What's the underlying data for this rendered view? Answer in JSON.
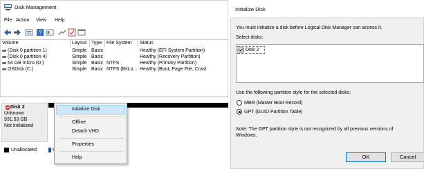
{
  "disk_management": {
    "title": "Disk Management",
    "menu": [
      "File",
      "Action",
      "View",
      "Help"
    ],
    "toolbar_icons": [
      "back-icon",
      "forward-icon",
      "list-view-icon",
      "help-icon",
      "properties-icon",
      "connect-icon",
      "check-icon",
      "panel-icon"
    ],
    "volume_table": {
      "columns": [
        "Volume",
        "Layout",
        "Type",
        "File System",
        "Status"
      ],
      "rows": [
        {
          "volume": "(Disk 0 partition 1)",
          "layout": "Simple",
          "type": "Basic",
          "fs": "",
          "status": "Healthy (EFI System Partition)"
        },
        {
          "volume": "(Disk 0 partition 4)",
          "layout": "Simple",
          "type": "Basic",
          "fs": "",
          "status": "Healthy (Recovery Partition)"
        },
        {
          "volume": "64 GB micro (D:)",
          "layout": "Simple",
          "type": "Basic",
          "fs": "NTFS",
          "status": "Healthy (Primary Partition)"
        },
        {
          "volume": "OSDisk (C:)",
          "layout": "Simple",
          "type": "Basic",
          "fs": "NTFS (BitLo...",
          "status": "Healthy (Boot, Page File, Crasl"
        }
      ]
    },
    "disk": {
      "name": "Disk 2",
      "kind": "Unknown",
      "size": "931.53 GB",
      "state": "Not Initialized"
    },
    "legend_unallocated": "Unallocated",
    "legend_p": "P",
    "context_menu": [
      "Initialize Disk",
      "Offline",
      "Detach VHD",
      "Properties",
      "Help"
    ]
  },
  "init_dialog": {
    "title": "Initialize Disk",
    "message": "You must initialize a disk before Logical Disk Manager can access it.",
    "select_label": "Select disks:",
    "disks": [
      {
        "label": "Disk 2",
        "checked": true
      }
    ],
    "partition_style_label": "Use the following partition style for the selected disks:",
    "options": [
      {
        "label": "MBR (Master Boot Record)",
        "selected": false
      },
      {
        "label": "GPT (GUID Partition Table)",
        "selected": true
      }
    ],
    "note": "Note: The GPT partition style is not recognized by all previous versions of",
    "note2": "Windows.",
    "ok": "OK",
    "cancel": "Cancel"
  }
}
